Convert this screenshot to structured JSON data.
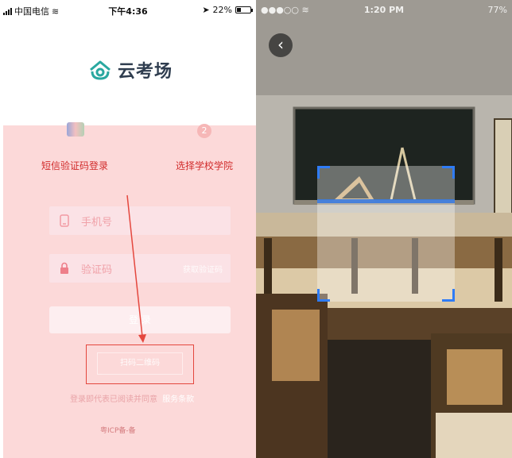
{
  "left": {
    "status": {
      "carrier": "中国电信",
      "time": "下午4:36",
      "battery": "22%"
    },
    "logo": {
      "text": "云考场"
    },
    "steps": [
      {
        "label": "短信验证码登录"
      },
      {
        "number": "2",
        "label": "选择学校学院"
      }
    ],
    "form": {
      "phone_placeholder": "手机号",
      "code_placeholder": "验证码",
      "get_code": "获取验证码"
    },
    "login_button": "登 录",
    "qr_button": "扫码二维码",
    "agree_text": "登录即代表已阅读并同意",
    "agree_link": "服务条款",
    "footer": "粤ICP备-备"
  },
  "right": {
    "status": {
      "time": "1:20 PM",
      "battery": "77%"
    },
    "back_icon": "chevron-left-icon"
  },
  "colors": {
    "brand_teal": "#2aa8a0",
    "logo_text": "#2f3d4f",
    "step_red": "#d12b2b",
    "panel_pink": "#fcd9d9",
    "annotation_red": "#e4473e",
    "scan_blue": "#2f7cf6"
  }
}
